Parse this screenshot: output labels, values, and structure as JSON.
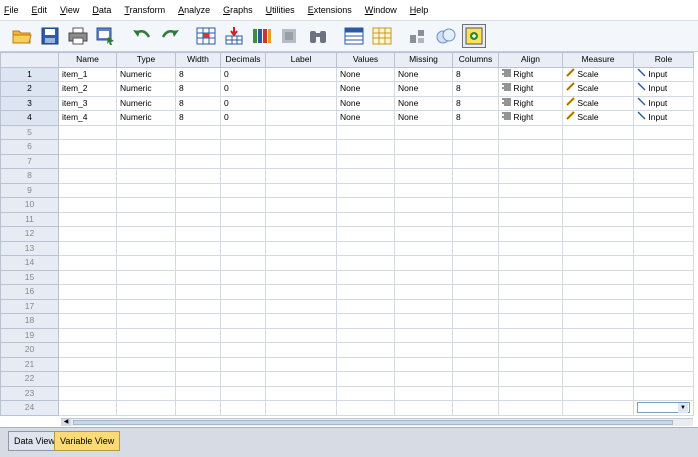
{
  "menu": [
    {
      "u": "F",
      "rest": "ile"
    },
    {
      "u": "E",
      "rest": "dit"
    },
    {
      "u": "V",
      "rest": "iew"
    },
    {
      "u": "D",
      "rest": "ata"
    },
    {
      "u": "T",
      "rest": "ransform"
    },
    {
      "u": "A",
      "rest": "nalyze"
    },
    {
      "u": "G",
      "rest": "raphs"
    },
    {
      "u": "U",
      "rest": "tilities"
    },
    {
      "u": "E",
      "rest": "xtensions"
    },
    {
      "u": "W",
      "rest": "indow"
    },
    {
      "u": "H",
      "rest": "elp"
    }
  ],
  "columns": [
    "Name",
    "Type",
    "Width",
    "Decimals",
    "Label",
    "Values",
    "Missing",
    "Columns",
    "Align",
    "Measure",
    "Role"
  ],
  "rows": [
    {
      "num": "1",
      "name": "item_1",
      "type": "Numeric",
      "width": "8",
      "decimals": "0",
      "label": "",
      "values": "None",
      "missing": "None",
      "columns": "8",
      "align": "Right",
      "measure": "Scale",
      "role": "Input"
    },
    {
      "num": "2",
      "name": "item_2",
      "type": "Numeric",
      "width": "8",
      "decimals": "0",
      "label": "",
      "values": "None",
      "missing": "None",
      "columns": "8",
      "align": "Right",
      "measure": "Scale",
      "role": "Input"
    },
    {
      "num": "3",
      "name": "item_3",
      "type": "Numeric",
      "width": "8",
      "decimals": "0",
      "label": "",
      "values": "None",
      "missing": "None",
      "columns": "8",
      "align": "Right",
      "measure": "Scale",
      "role": "Input"
    },
    {
      "num": "4",
      "name": "item_4",
      "type": "Numeric",
      "width": "8",
      "decimals": "0",
      "label": "",
      "values": "None",
      "missing": "None",
      "columns": "8",
      "align": "Right",
      "measure": "Scale",
      "role": "Input"
    }
  ],
  "empty_rows": [
    "5",
    "6",
    "7",
    "8",
    "9",
    "10",
    "11",
    "12",
    "13",
    "14",
    "15",
    "16",
    "17",
    "18",
    "19",
    "20",
    "21",
    "22",
    "23",
    "24"
  ],
  "tabs": {
    "data_view": "Data View",
    "variable_view": "Variable View"
  },
  "colors": {
    "active_tab": "#fddb74",
    "header_bg": "#e8edf6"
  }
}
